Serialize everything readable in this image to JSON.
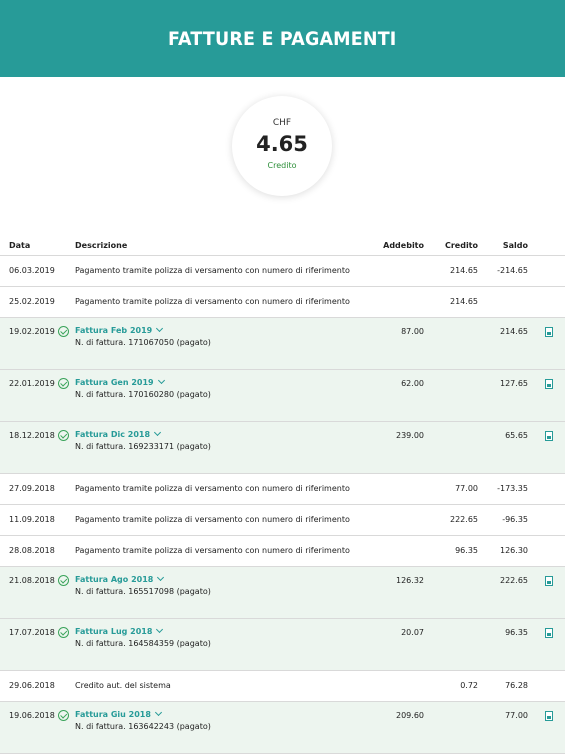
{
  "header": {
    "title": "FATTURE E PAGAMENTI"
  },
  "balance": {
    "currency": "CHF",
    "amount": "4.65",
    "label": "Credito"
  },
  "table": {
    "columns": {
      "date": "Data",
      "description": "Descrizione",
      "debit": "Addebito",
      "credit": "Credito",
      "balance": "Saldo"
    },
    "rows": [
      {
        "type": "simple",
        "date": "06.03.2019",
        "description": "Pagamento tramite polizza di versamento con numero di riferimento",
        "debit": "",
        "credit": "214.65",
        "balance": "-214.65"
      },
      {
        "type": "simple",
        "date": "25.02.2019",
        "description": "Pagamento tramite polizza di versamento con numero di riferimento",
        "debit": "",
        "credit": "214.65",
        "balance": ""
      },
      {
        "type": "invoice",
        "date": "19.02.2019",
        "title": "Fattura Feb 2019",
        "number": "N. di fattura. 171067050 (pagato)",
        "debit": "87.00",
        "credit": "",
        "balance": "214.65"
      },
      {
        "type": "invoice",
        "date": "22.01.2019",
        "title": "Fattura Gen 2019",
        "number": "N. di fattura. 170160280 (pagato)",
        "debit": "62.00",
        "credit": "",
        "balance": "127.65"
      },
      {
        "type": "invoice",
        "date": "18.12.2018",
        "title": "Fattura Dic 2018",
        "number": "N. di fattura. 169233171 (pagato)",
        "debit": "239.00",
        "credit": "",
        "balance": "65.65"
      },
      {
        "type": "simple",
        "date": "27.09.2018",
        "description": "Pagamento tramite polizza di versamento con numero di riferimento",
        "debit": "",
        "credit": "77.00",
        "balance": "-173.35"
      },
      {
        "type": "simple",
        "date": "11.09.2018",
        "description": "Pagamento tramite polizza di versamento con numero di riferimento",
        "debit": "",
        "credit": "222.65",
        "balance": "-96.35"
      },
      {
        "type": "simple",
        "date": "28.08.2018",
        "description": "Pagamento tramite polizza di versamento con numero di riferimento",
        "debit": "",
        "credit": "96.35",
        "balance": "126.30"
      },
      {
        "type": "invoice",
        "date": "21.08.2018",
        "title": "Fattura Ago 2018",
        "number": "N. di fattura. 165517098 (pagato)",
        "debit": "126.32",
        "credit": "",
        "balance": "222.65"
      },
      {
        "type": "invoice",
        "date": "17.07.2018",
        "title": "Fattura Lug 2018",
        "number": "N. di fattura. 164584359 (pagato)",
        "debit": "20.07",
        "credit": "",
        "balance": "96.35"
      },
      {
        "type": "simple",
        "date": "29.06.2018",
        "description": "Credito aut. del sistema",
        "debit": "",
        "credit": "0.72",
        "balance": "76.28"
      },
      {
        "type": "invoice",
        "date": "19.06.2018",
        "title": "Fattura Giu 2018",
        "number": "N. di fattura. 163642243 (pagato)",
        "debit": "209.60",
        "credit": "",
        "balance": "77.00"
      }
    ]
  },
  "icons": {
    "paid": "check-circle-icon",
    "expand": "chevron-down-icon",
    "download": "pdf-icon"
  },
  "colors": {
    "brand": "#279b98",
    "credit_green": "#2e8f3a",
    "invoice_row_bg": "#edf5ef"
  }
}
